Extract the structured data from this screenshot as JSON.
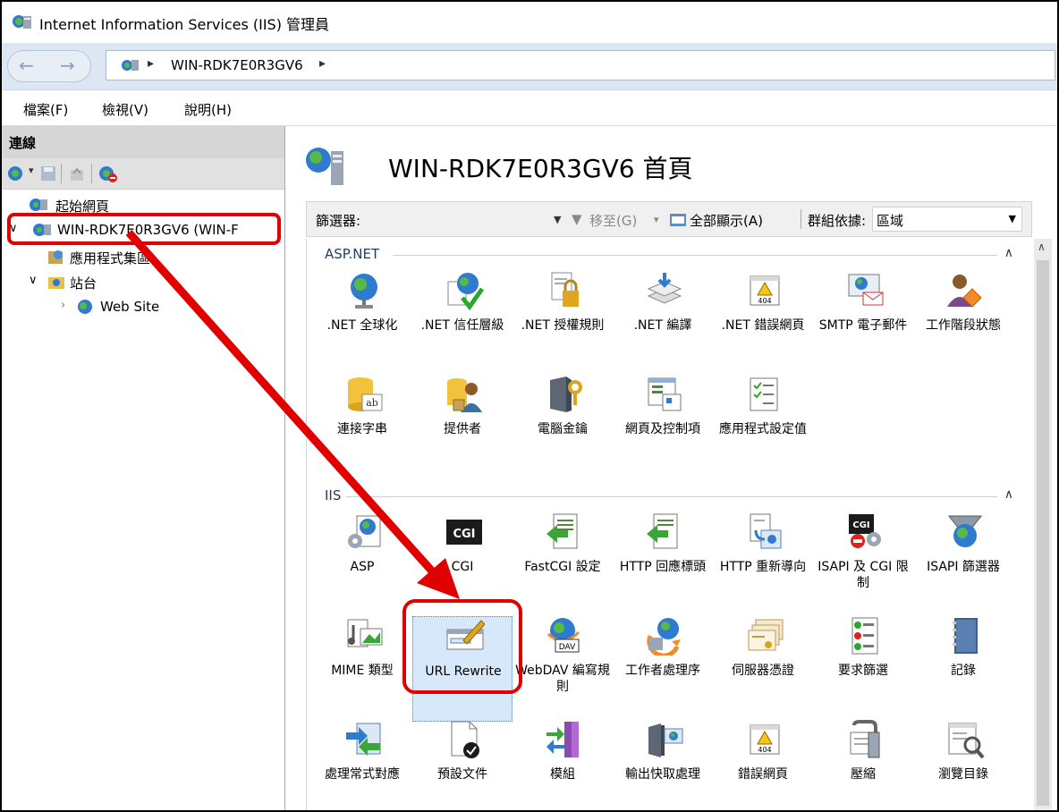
{
  "window": {
    "title": "Internet Information Services (IIS) 管理員"
  },
  "address": {
    "items": [
      "WIN-RDK7E0R3GV6"
    ]
  },
  "menu": {
    "file": "檔案(F)",
    "view": "檢視(V)",
    "help": "說明(H)"
  },
  "connections": {
    "header": "連線",
    "tree": {
      "start_page": "起始網頁",
      "server": "WIN-RDK7E0R3GV6 (WIN-F",
      "app_pools": "應用程式集區",
      "sites": "站台",
      "web_site": "Web Site"
    }
  },
  "main": {
    "page_title": "WIN-RDK7E0R3GV6 首頁",
    "filter_label": "篩選器:",
    "go_label": "移至(G)",
    "show_all_label": "全部顯示(A)",
    "group_by_label": "群組依據:",
    "group_by_value": "區域",
    "groups": [
      {
        "name": "ASP.NET",
        "items": [
          ".NET 全球化",
          ".NET 信任層級",
          ".NET 授權規則",
          ".NET 編譯",
          ".NET 錯誤網頁",
          "SMTP 電子郵件",
          "工作階段狀態",
          "連接字串",
          "提供者",
          "電腦金鑰",
          "網頁及控制項",
          "應用程式設定值"
        ]
      },
      {
        "name": "IIS",
        "items": [
          "ASP",
          "CGI",
          "FastCGI 設定",
          "HTTP 回應標頭",
          "HTTP 重新導向",
          "ISAPI 及 CGI 限制",
          "ISAPI 篩選器",
          "MIME 類型",
          "URL Rewrite",
          "WebDAV 編寫規則",
          "工作者處理序",
          "伺服器憑證",
          "要求篩選",
          "記錄",
          "處理常式對應",
          "預設文件",
          "模組",
          "輸出快取處理",
          "錯誤網頁",
          "壓縮",
          "瀏覽目錄"
        ]
      }
    ]
  },
  "icons": {
    "cgi_text": "CGI",
    "dav_text": "DAV",
    "err_text": "404"
  }
}
